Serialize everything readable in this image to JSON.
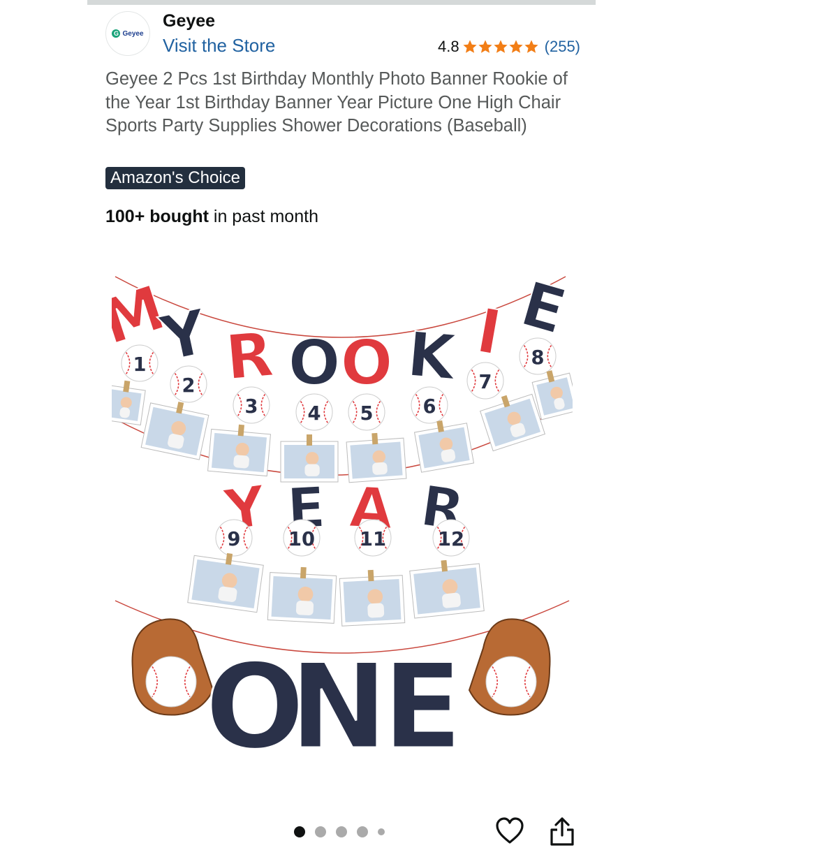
{
  "brand": {
    "logo_text": "Geyee",
    "logo_mark": "G",
    "name": "Geyee",
    "store_link": "Visit the Store"
  },
  "rating": {
    "score": "4.8",
    "stars": 5,
    "count": "(255)",
    "star_color": "#f27e16"
  },
  "product": {
    "title": "Geyee 2 Pcs 1st Birthday Monthly Photo Banner Rookie of the Year 1st Birthday Banner Year Picture One High Chair Sports Party Supplies Shower Decorations (Baseball)",
    "badge": "Amazon's Choice",
    "bought_bold": "100+ bought",
    "bought_rest": " in past month"
  },
  "image": {
    "row1_letters": [
      "M",
      "Y",
      "R",
      "O",
      "O",
      "K",
      "I",
      "E"
    ],
    "row1_numbers": [
      "1",
      "2",
      "3",
      "4",
      "5",
      "6",
      "7",
      "8"
    ],
    "row2_letters": [
      "Y",
      "E",
      "A",
      "R"
    ],
    "row2_numbers": [
      "9",
      "10",
      "11",
      "12"
    ],
    "row3_text": "ONE",
    "colors": {
      "red": "#e03a3e",
      "navy": "#2a3149",
      "glove": "#b86a34",
      "string": "#c9473d"
    }
  },
  "carousel": {
    "dot_count": 5,
    "active_index": 0
  },
  "actions": {
    "heart": "heart-icon",
    "share": "share-icon"
  }
}
